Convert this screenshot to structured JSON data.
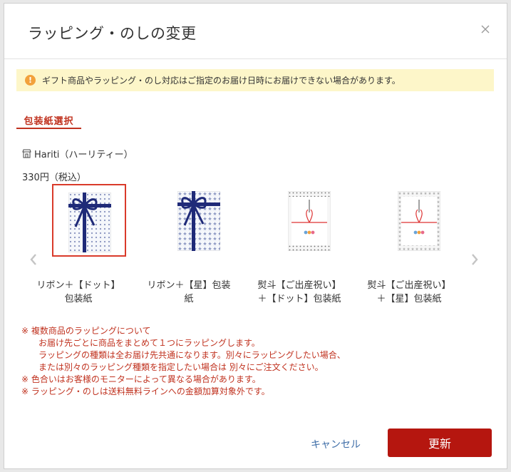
{
  "dialog": {
    "title": "ラッピング・のしの変更"
  },
  "notice": {
    "icon": "!",
    "text": "ギフト商品やラッピング・のし対応はご指定のお届け日時にお届けできない場合があります。"
  },
  "section": {
    "tab_label": "包装紙選択"
  },
  "shop": {
    "icon": "shop-icon",
    "name": "Hariti（ハーリティー）"
  },
  "price": "330円（税込）",
  "items": [
    {
      "label_line1": "リボン＋【ドット】",
      "label_line2": "包装紙",
      "selected": true
    },
    {
      "label_line1": "リボン＋【星】包装",
      "label_line2": "紙",
      "selected": false
    },
    {
      "label_line1": "熨斗【ご出産祝い】",
      "label_line2": "＋【ドット】包装紙",
      "selected": false
    },
    {
      "label_line1": "熨斗【ご出産祝い】",
      "label_line2": "＋【星】包装紙",
      "selected": false
    }
  ],
  "notes": [
    "※ 複数商品のラッピングについて",
    "　　お届け先ごとに商品をまとめて１つにラッピングします。",
    "　　ラッピングの種類は全お届け先共通になります。別々にラッピングしたい場合、",
    "　　または別々のラッピング種類を指定したい場合は 別々にご注文ください。",
    "※ 色合いはお客様のモニターによって異なる場合があります。",
    "※ ラッピング・のしは送料無料ラインへの金額加算対象外です。"
  ],
  "footer": {
    "cancel_label": "キャンセル",
    "update_label": "更新"
  },
  "colors": {
    "accent": "#c0321f",
    "button": "#b5160f",
    "link": "#3f6ea8",
    "notice_bg": "#fdf6c9",
    "ribbon": "#1f2a78"
  }
}
